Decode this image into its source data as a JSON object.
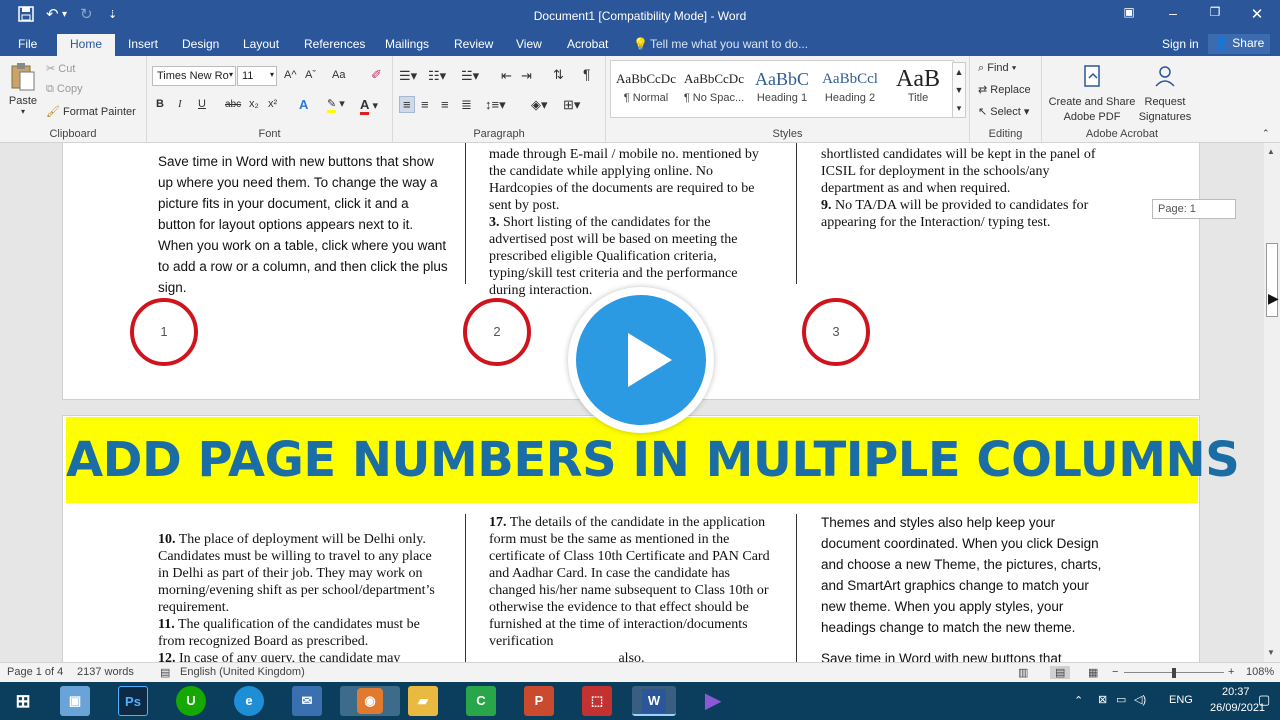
{
  "window": {
    "title": "Document1 [Compatibility Mode] - Word",
    "qa_icons": [
      "save-icon",
      "undo-icon",
      "redo-icon",
      "customize-icon"
    ]
  },
  "tabs": [
    "File",
    "Home",
    "Insert",
    "Design",
    "Layout",
    "References",
    "Mailings",
    "Review",
    "View",
    "Acrobat"
  ],
  "active_tab": "Home",
  "tell_me": "Tell me what you want to do...",
  "sign_in": "Sign in",
  "share": "Share",
  "ribbon": {
    "clipboard": {
      "paste": "Paste",
      "cut": "Cut",
      "copy": "Copy",
      "format_painter": "Format Painter",
      "label": "Clipboard"
    },
    "font": {
      "name": "Times New Ro",
      "size": "11",
      "label": "Font",
      "bold": "B",
      "italic": "I",
      "underline": "U",
      "strike": "abc",
      "sub": "x₂",
      "sup": "x²",
      "grow": "A^",
      "shrink": "Aˇ",
      "case": "Aa"
    },
    "paragraph": {
      "label": "Paragraph"
    },
    "styles": {
      "label": "Styles",
      "items": [
        {
          "preview": "AaBbCcDc",
          "name": "¶ Normal"
        },
        {
          "preview": "AaBbCcDc",
          "name": "¶ No Spac..."
        },
        {
          "preview": "AaBbC",
          "name": "Heading 1"
        },
        {
          "preview": "AaBbCcl",
          "name": "Heading 2"
        },
        {
          "preview": "AaB",
          "name": "Title"
        }
      ]
    },
    "editing": {
      "find": "Find",
      "replace": "Replace",
      "select": "Select",
      "label": "Editing"
    },
    "acrobat": {
      "create_share": "Create and Share",
      "adobe_pdf": "Adobe PDF",
      "request": "Request",
      "signatures": "Signatures",
      "label": "Adobe Acrobat"
    }
  },
  "page_tooltip": "Page: 1",
  "page1": {
    "col1": "Save time in Word with new buttons that show up where you need them. To change the way a picture fits in your document, click it and a button for layout options appears next to it. When you work on a table, click where you want to add a row or a column, and then click the plus sign.",
    "col2_a": "made through E-mail / mobile no. mentioned by the candidate while applying online. No Hardcopies of the documents are required to be sent by post.",
    "col2_b_num": "3.",
    "col2_b": "Short listing of the candidates for the advertised post will be based on meeting the prescribed eligible Qualification criteria, typing/skill test criteria and the performance during interaction.",
    "col3_a": "shortlisted candidates will be kept in the panel of ICSIL for deployment in the schools/any department as and when required.",
    "col3_b_num": "9.",
    "col3_b": "No TA/DA will be provided to candidates for appearing for the Interaction/ typing test.",
    "numbers": [
      "1",
      "2",
      "3"
    ]
  },
  "banner": "ADD PAGE NUMBERS IN MULTIPLE COLUMNS",
  "page2": {
    "col1_a_num": "10.",
    "col1_a": "The place of deployment will be Delhi only. Candidates must be willing to travel to any place in Delhi as part of their job. They may work on morning/evening shift as per school/department’s requirement.",
    "col1_b_num": "11.",
    "col1_b": "The qualification of the candidates must be from recognized Board as prescribed.",
    "col1_c_num": "12.",
    "col1_c": "In case of any query, the candidate may",
    "col2_num": "17.",
    "col2": "The details of the candidate in the application form must be the same as mentioned in the certificate of Class 10th Certificate and PAN Card and Aadhar Card. In case the candidate has changed his/her name subsequent to Class 10th or otherwise the evidence to that effect should be furnished at the time of interaction/documents verification",
    "col2_tail": "also.",
    "col3_a": "Themes and styles also help keep your document coordinated. When you click Design and choose a new Theme, the pictures, charts, and SmartArt graphics change to match your new theme. When you apply styles, your headings change to match the new theme.",
    "col3_b": "Save time in Word with new buttons that"
  },
  "status": {
    "page": "Page 1 of 4",
    "words": "2137 words",
    "language": "English (United Kingdom)",
    "zoom": "108%"
  },
  "taskbar": {
    "apps": [
      "windows-icon",
      "control-panel-icon",
      "photoshop-icon",
      "upwork-icon",
      "edge-icon",
      "mail-icon",
      "recorder-icon",
      "explorer-icon",
      "camtasia-icon",
      "powerpoint-icon",
      "pdf-icon",
      "word-icon",
      "vs-icon"
    ],
    "lang": "ENG",
    "time": "20:37",
    "date": "26/09/2021"
  },
  "colors": {
    "word_blue": "#2b579a",
    "circle_red": "#d0141e",
    "banner_yellow": "#ffff00",
    "banner_text": "#1b6ea5",
    "play_blue": "#2b9ae3"
  }
}
